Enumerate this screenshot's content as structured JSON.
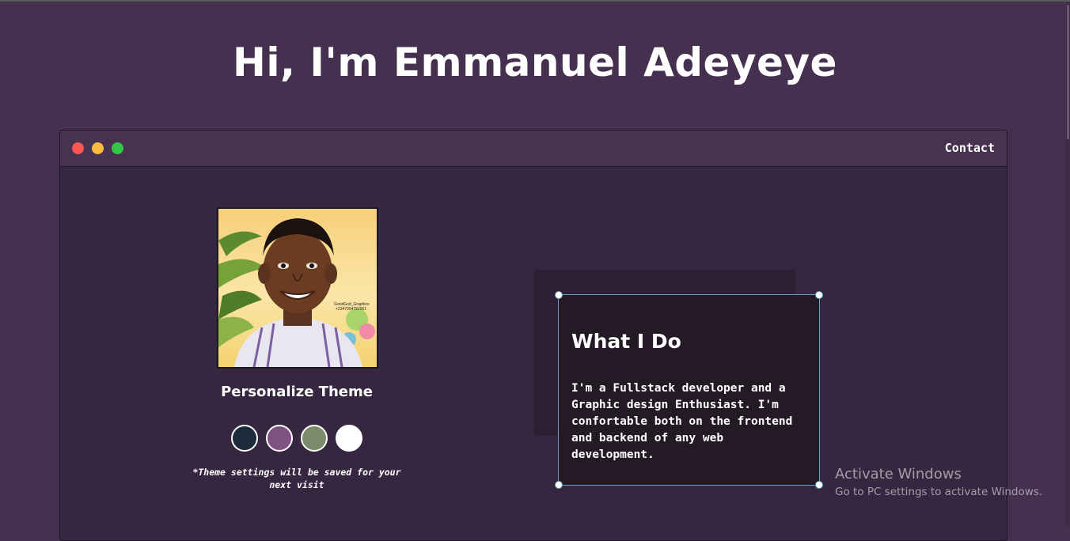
{
  "hero": {
    "title": "Hi, I'm Emmanuel Adeyeye"
  },
  "window": {
    "controls": [
      "close",
      "minimize",
      "maximize"
    ],
    "nav": {
      "contact_label": "Contact"
    }
  },
  "profile": {
    "avatar_watermark_line1": "GoodGod_Graphics",
    "avatar_watermark_line2": "+2347064792961"
  },
  "theme": {
    "title": "Personalize Theme",
    "swatches": [
      {
        "name": "dark",
        "color": "#1c2b3a"
      },
      {
        "name": "purple",
        "color": "#7e5384"
      },
      {
        "name": "green",
        "color": "#7a8c6a"
      },
      {
        "name": "light",
        "color": "#ffffff"
      }
    ],
    "note": "*Theme settings will be saved for your next visit"
  },
  "about": {
    "heading": "What I Do",
    "body": "I'm a Fullstack developer and a Graphic design Enthusiast. I'm confortable both on the frontend and backend of any web development."
  },
  "os_overlay": {
    "title": "Activate Windows",
    "subtitle": "Go to PC settings to activate Windows."
  },
  "colors": {
    "page_bg": "#45314f",
    "window_bg": "#37263f",
    "card_bg": "#231a26",
    "selection": "#5ea3c7"
  }
}
